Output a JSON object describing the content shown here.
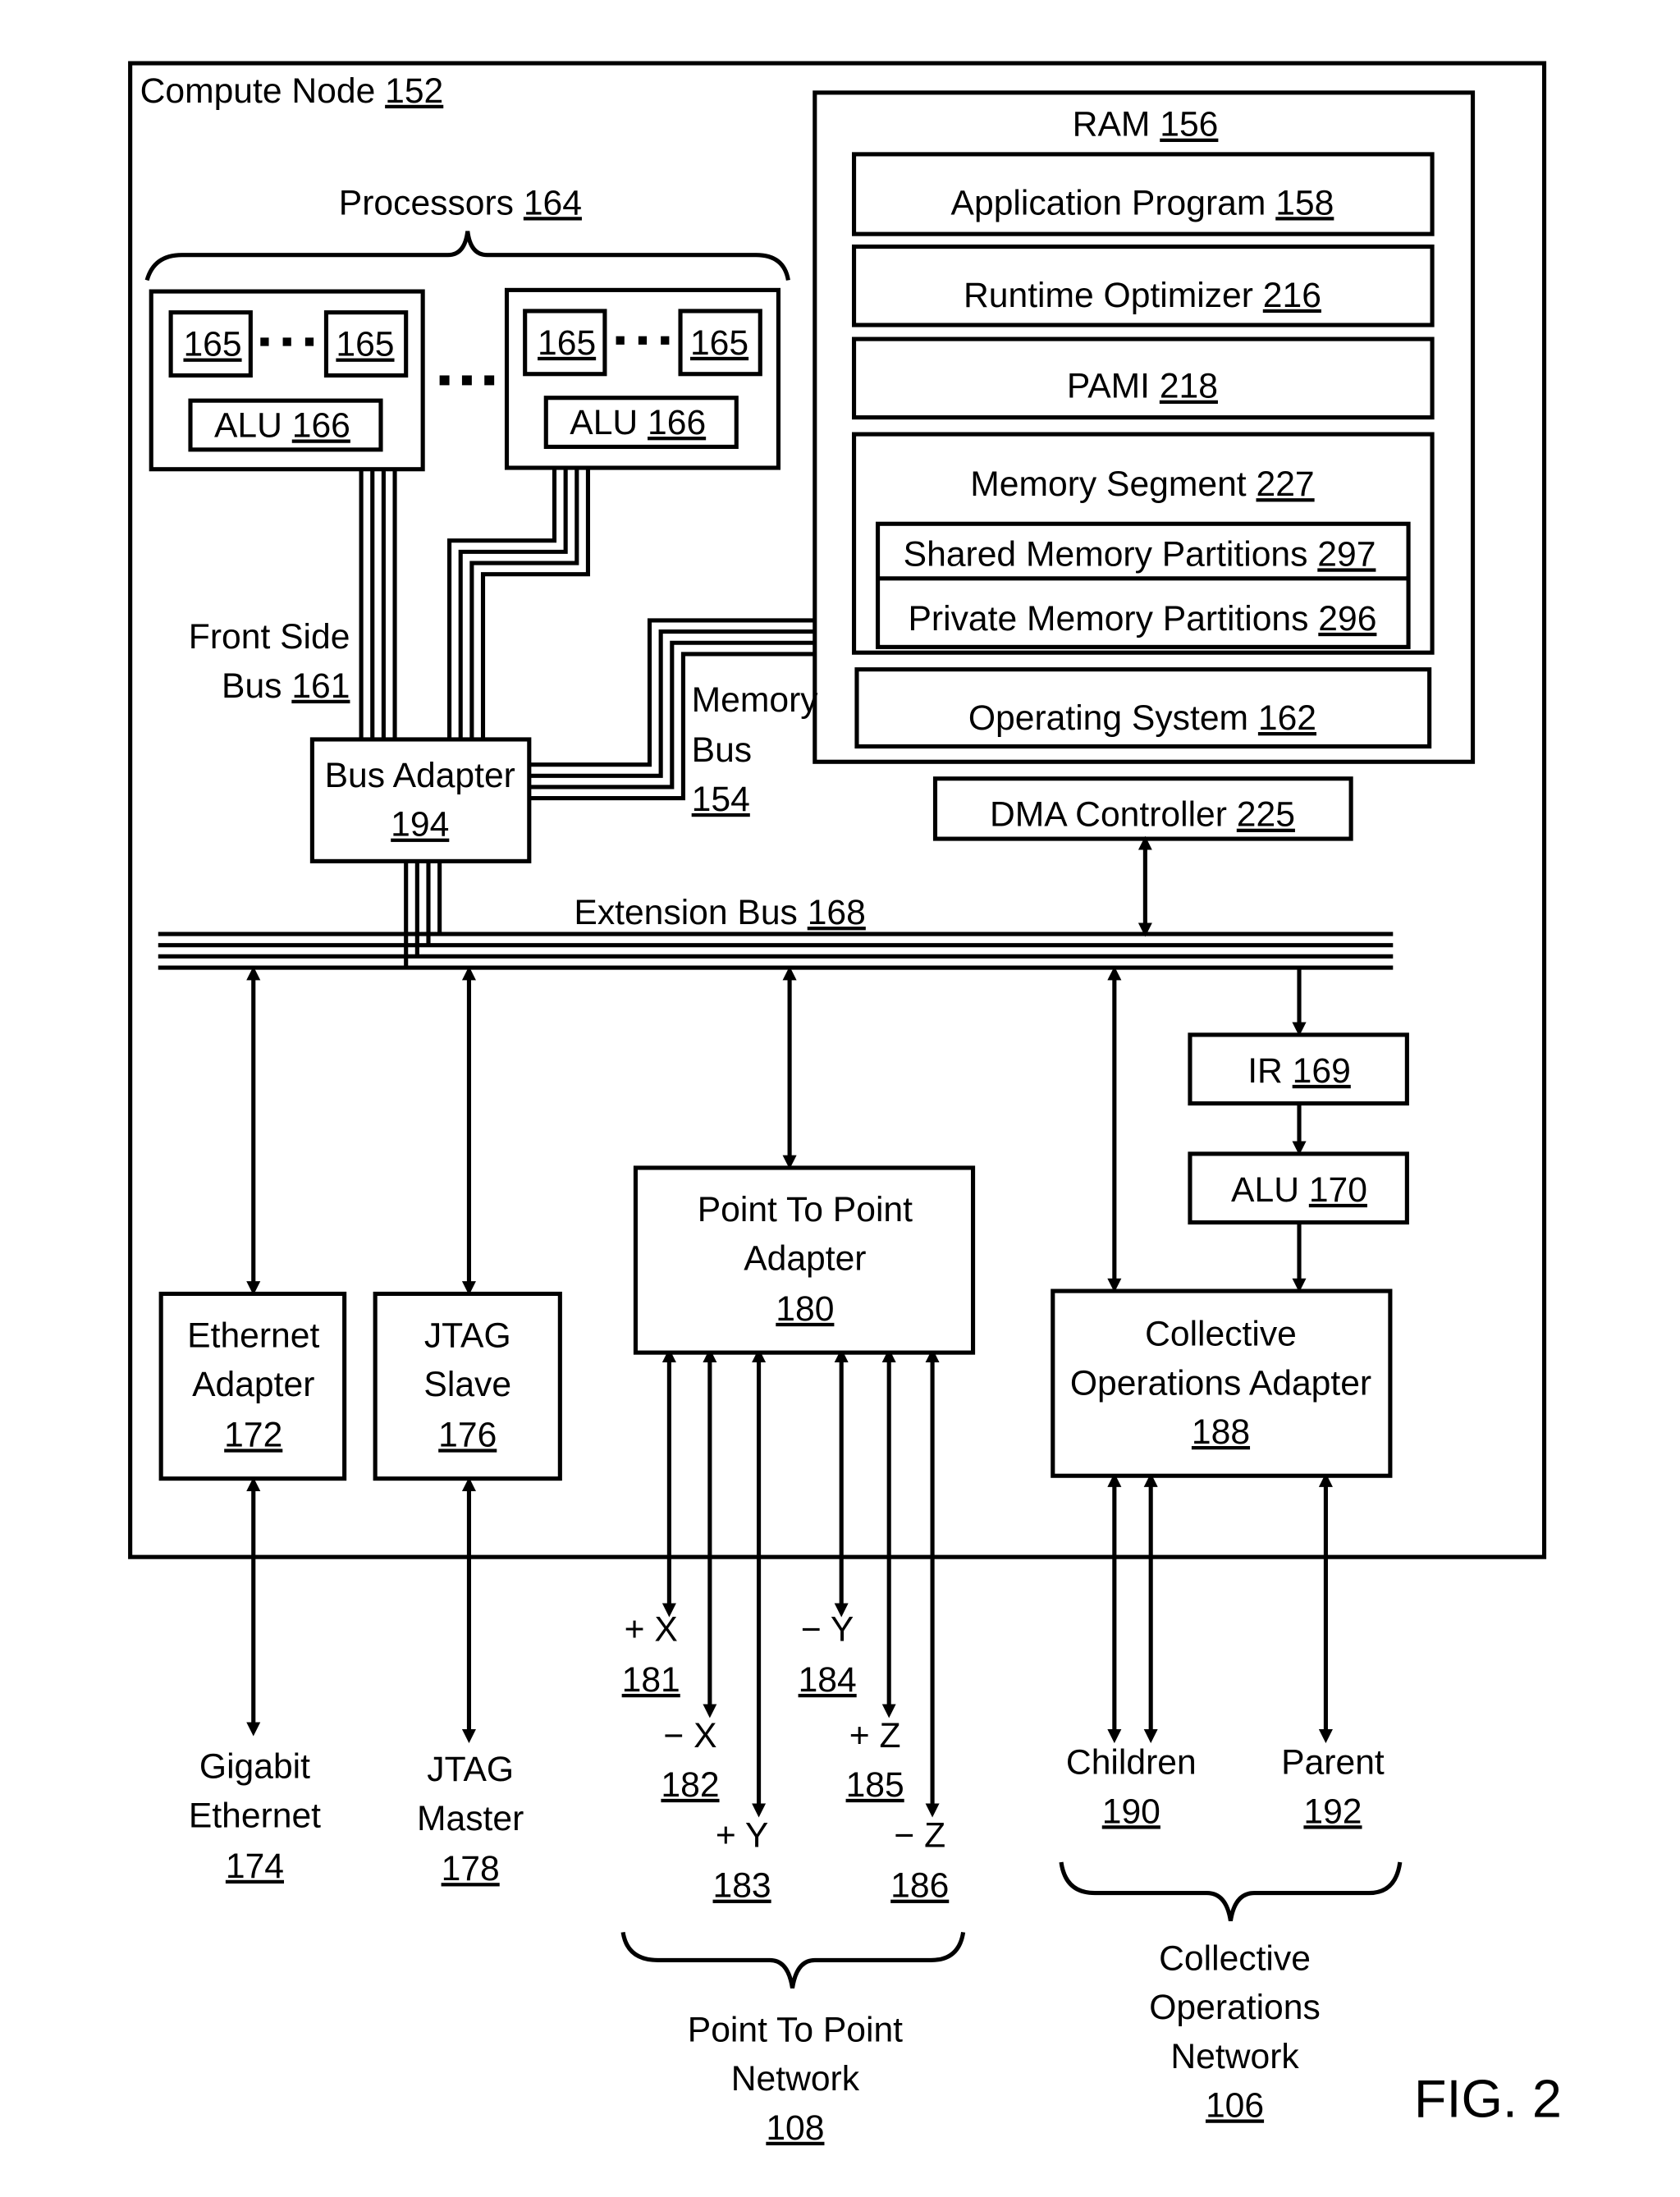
{
  "compute_node": {
    "label": "Compute Node",
    "ref": "152"
  },
  "processors": {
    "label": "Processors",
    "ref": "164",
    "core_ref": "165",
    "alu_label": "ALU",
    "alu_ref": "166"
  },
  "ram": {
    "label": "RAM",
    "ref": "156",
    "app": {
      "label": "Application Program",
      "ref": "158"
    },
    "optimizer": {
      "label": "Runtime Optimizer",
      "ref": "216"
    },
    "pami": {
      "label": "PAMI",
      "ref": "218"
    },
    "segment": {
      "label": "Memory Segment",
      "ref": "227"
    },
    "shared": {
      "label": "Shared Memory Partitions",
      "ref": "297"
    },
    "private": {
      "label": "Private Memory Partitions",
      "ref": "296"
    },
    "os": {
      "label": "Operating System",
      "ref": "162"
    }
  },
  "fsb": {
    "line1": "Front Side",
    "line2": "Bus",
    "ref": "161"
  },
  "membus": {
    "line1": "Memory",
    "line2": "Bus",
    "ref": "154"
  },
  "bus_adapter": {
    "label": "Bus Adapter",
    "ref": "194"
  },
  "dma": {
    "label": "DMA Controller",
    "ref": "225"
  },
  "extbus": {
    "label": "Extension Bus",
    "ref": "168"
  },
  "ir": {
    "label": "IR",
    "ref": "169"
  },
  "alu170": {
    "label": "ALU",
    "ref": "170"
  },
  "eth": {
    "line1": "Ethernet",
    "line2": "Adapter",
    "ref": "172"
  },
  "jtag": {
    "line1": "JTAG",
    "line2": "Slave",
    "ref": "176"
  },
  "p2p": {
    "line1": "Point To Point",
    "line2": "Adapter",
    "ref": "180"
  },
  "coll": {
    "line1": "Collective",
    "line2": "Operations Adapter",
    "ref": "188"
  },
  "gig": {
    "line1": "Gigabit",
    "line2": "Ethernet",
    "ref": "174"
  },
  "jmaster": {
    "line1": "JTAG",
    "line2": "Master",
    "ref": "178"
  },
  "links": {
    "px": "+ X",
    "px_ref": "181",
    "mx": "− X",
    "mx_ref": "182",
    "py": "+ Y",
    "py_ref": "183",
    "my": "− Y",
    "my_ref": "184",
    "pz": "+ Z",
    "pz_ref": "185",
    "mz": "− Z",
    "mz_ref": "186"
  },
  "children": {
    "label": "Children",
    "ref": "190"
  },
  "parent": {
    "label": "Parent",
    "ref": "192"
  },
  "p2pnet": {
    "line1": "Point To Point",
    "line2": "Network",
    "ref": "108"
  },
  "collnet": {
    "line1": "Collective",
    "line2": "Operations",
    "line3": "Network",
    "ref": "106"
  },
  "fig": "FIG. 2"
}
